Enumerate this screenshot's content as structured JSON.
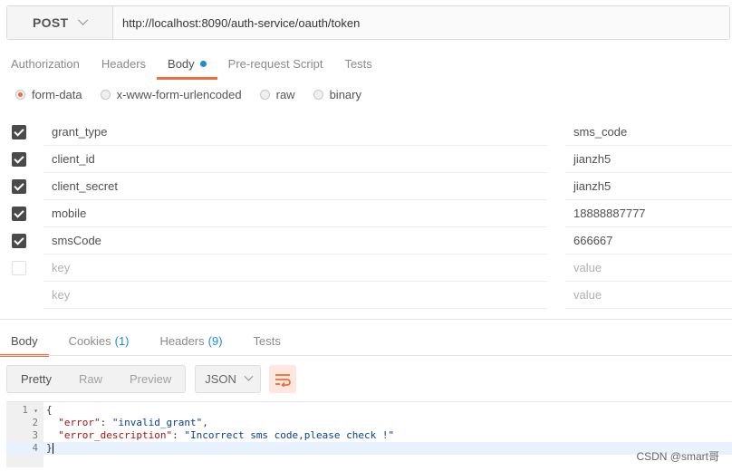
{
  "request": {
    "method": "POST",
    "url": "http://localhost:8090/auth-service/oauth/token"
  },
  "request_tabs": [
    {
      "label": "Authorization"
    },
    {
      "label": "Headers"
    },
    {
      "label": "Body"
    },
    {
      "label": "Pre-request Script"
    },
    {
      "label": "Tests"
    }
  ],
  "body_types": [
    {
      "label": "form-data",
      "selected": true
    },
    {
      "label": "x-www-form-urlencoded",
      "selected": false
    },
    {
      "label": "raw",
      "selected": false
    },
    {
      "label": "binary",
      "selected": false
    }
  ],
  "form_rows": [
    {
      "key": "grant_type",
      "value": "sms_code",
      "checked": true
    },
    {
      "key": "client_id",
      "value": "jianzh5",
      "checked": true
    },
    {
      "key": "client_secret",
      "value": "jianzh5",
      "checked": true
    },
    {
      "key": "mobile",
      "value": "18888887777",
      "checked": true
    },
    {
      "key": "smsCode",
      "value": "666667",
      "checked": true
    }
  ],
  "placeholders": {
    "key": "key",
    "value": "value"
  },
  "response_tabs": [
    {
      "label": "Body",
      "count": ""
    },
    {
      "label": "Cookies",
      "count": "(1)"
    },
    {
      "label": "Headers",
      "count": "(9)"
    },
    {
      "label": "Tests",
      "count": ""
    }
  ],
  "view_modes": [
    "Pretty",
    "Raw",
    "Preview"
  ],
  "format": "JSON",
  "response_lines": [
    {
      "num": "1",
      "text": "{"
    },
    {
      "num": "2",
      "key": "\"error\"",
      "value": "\"invalid_grant\","
    },
    {
      "num": "3",
      "key": "\"error_description\"",
      "value": "\"Incorrect sms code,please check !\""
    },
    {
      "num": "4",
      "text": "}"
    }
  ],
  "watermark": "CSDN @smart哥",
  "colors": {
    "accent": "#f26b3a",
    "link": "#1b8cd9"
  }
}
